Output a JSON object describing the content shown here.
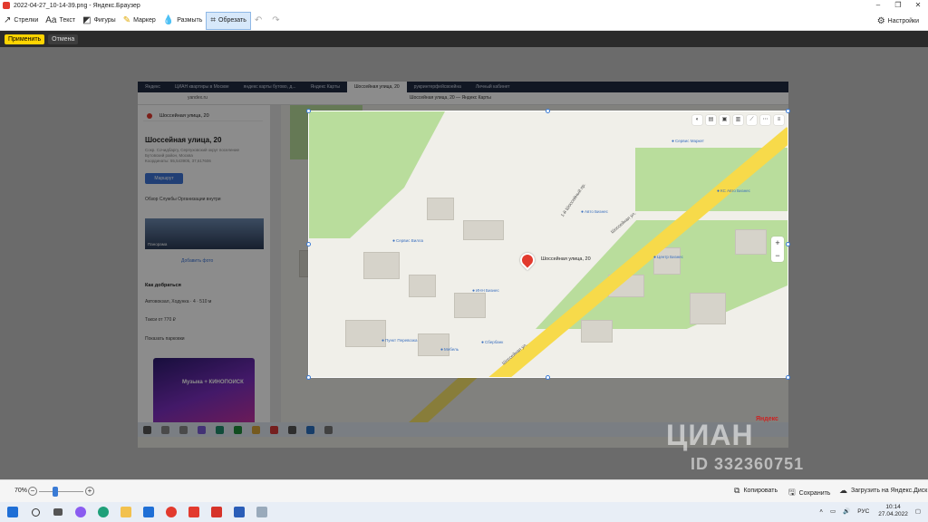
{
  "titlebar": {
    "title": "2022-04-27_10-14-39.png - Яндекс.Браузер"
  },
  "toolbar": {
    "tools": [
      {
        "label": "Стрелки",
        "icon": "arrow-icon"
      },
      {
        "label": "Текст",
        "icon": "text-icon"
      },
      {
        "label": "Фигуры",
        "icon": "shapes-icon"
      },
      {
        "label": "Маркер",
        "icon": "marker-icon"
      },
      {
        "label": "Размыть",
        "icon": "blur-icon"
      },
      {
        "label": "Обрезать",
        "icon": "crop-icon"
      }
    ],
    "settings_label": "Настройки"
  },
  "actions": {
    "apply": "Применить",
    "cancel": "Отмена"
  },
  "inner_browser": {
    "tabs": [
      "Яндекс",
      "ЦИАН квартиры в Москве",
      "яндекс карты бутово, д...",
      "Яндекс Карты",
      "Шоссейная улица, 20",
      "рукринтерфейсвоейна",
      "Личный кабинет"
    ],
    "url": "yandex.ru",
    "page_title": "Шоссейная улица, 20 — Яндекс Карты"
  },
  "sidebar": {
    "search_value": "Шоссейная улица, 20",
    "heading": "Шоссейная улица, 20",
    "subtitle": "Сокр. Сочидбаргу, Серпуховский округ поселение Бутовский район, Москва",
    "coords": "Координаты: 55,543905, 37,617606",
    "route_button": "Маршрут",
    "tabs": "Обзор   Службы   Организации внутри",
    "photo_label": "Панорама",
    "add_photo": "Добавить фото",
    "how_to_get": "Как добраться",
    "lines": [
      "Автовокзал, Ходунка · 4 · 510 м",
      "Такси от 770 ₽",
      "Показать парковки"
    ],
    "ad_text": "Музыка + КИНОПОИСК"
  },
  "map": {
    "marker_label": "Шоссейная улица, 20",
    "pois": [
      "Сервис Вилла",
      "ИНН Бизнес",
      "Авто Бизнес",
      "Центр Бизнес",
      "Сбербанк",
      "КС Авто Бизнес",
      "Сервис Маркет",
      "Мебель",
      "Пункт Перевозка"
    ],
    "streets": [
      "Шоссейная ул.",
      "Шоссейная ул.",
      "1-й Шоссейный пр."
    ],
    "copyright": "Яндекс"
  },
  "status": {
    "zoom": "70%",
    "zoom_fraction": 0.55,
    "copy": "Копировать",
    "save": "Сохранить",
    "upload": "Загрузить на Яндекс.Диск"
  },
  "tray": {
    "lang": "РУС",
    "time": "10:14",
    "date": "27.04.2022"
  },
  "watermark": {
    "line1": "ЦИАН",
    "line2": "ID 332360751"
  },
  "colors": {
    "accent": "#3a7bd5",
    "apply": "#ffd400",
    "marker": "#e23a2e"
  }
}
